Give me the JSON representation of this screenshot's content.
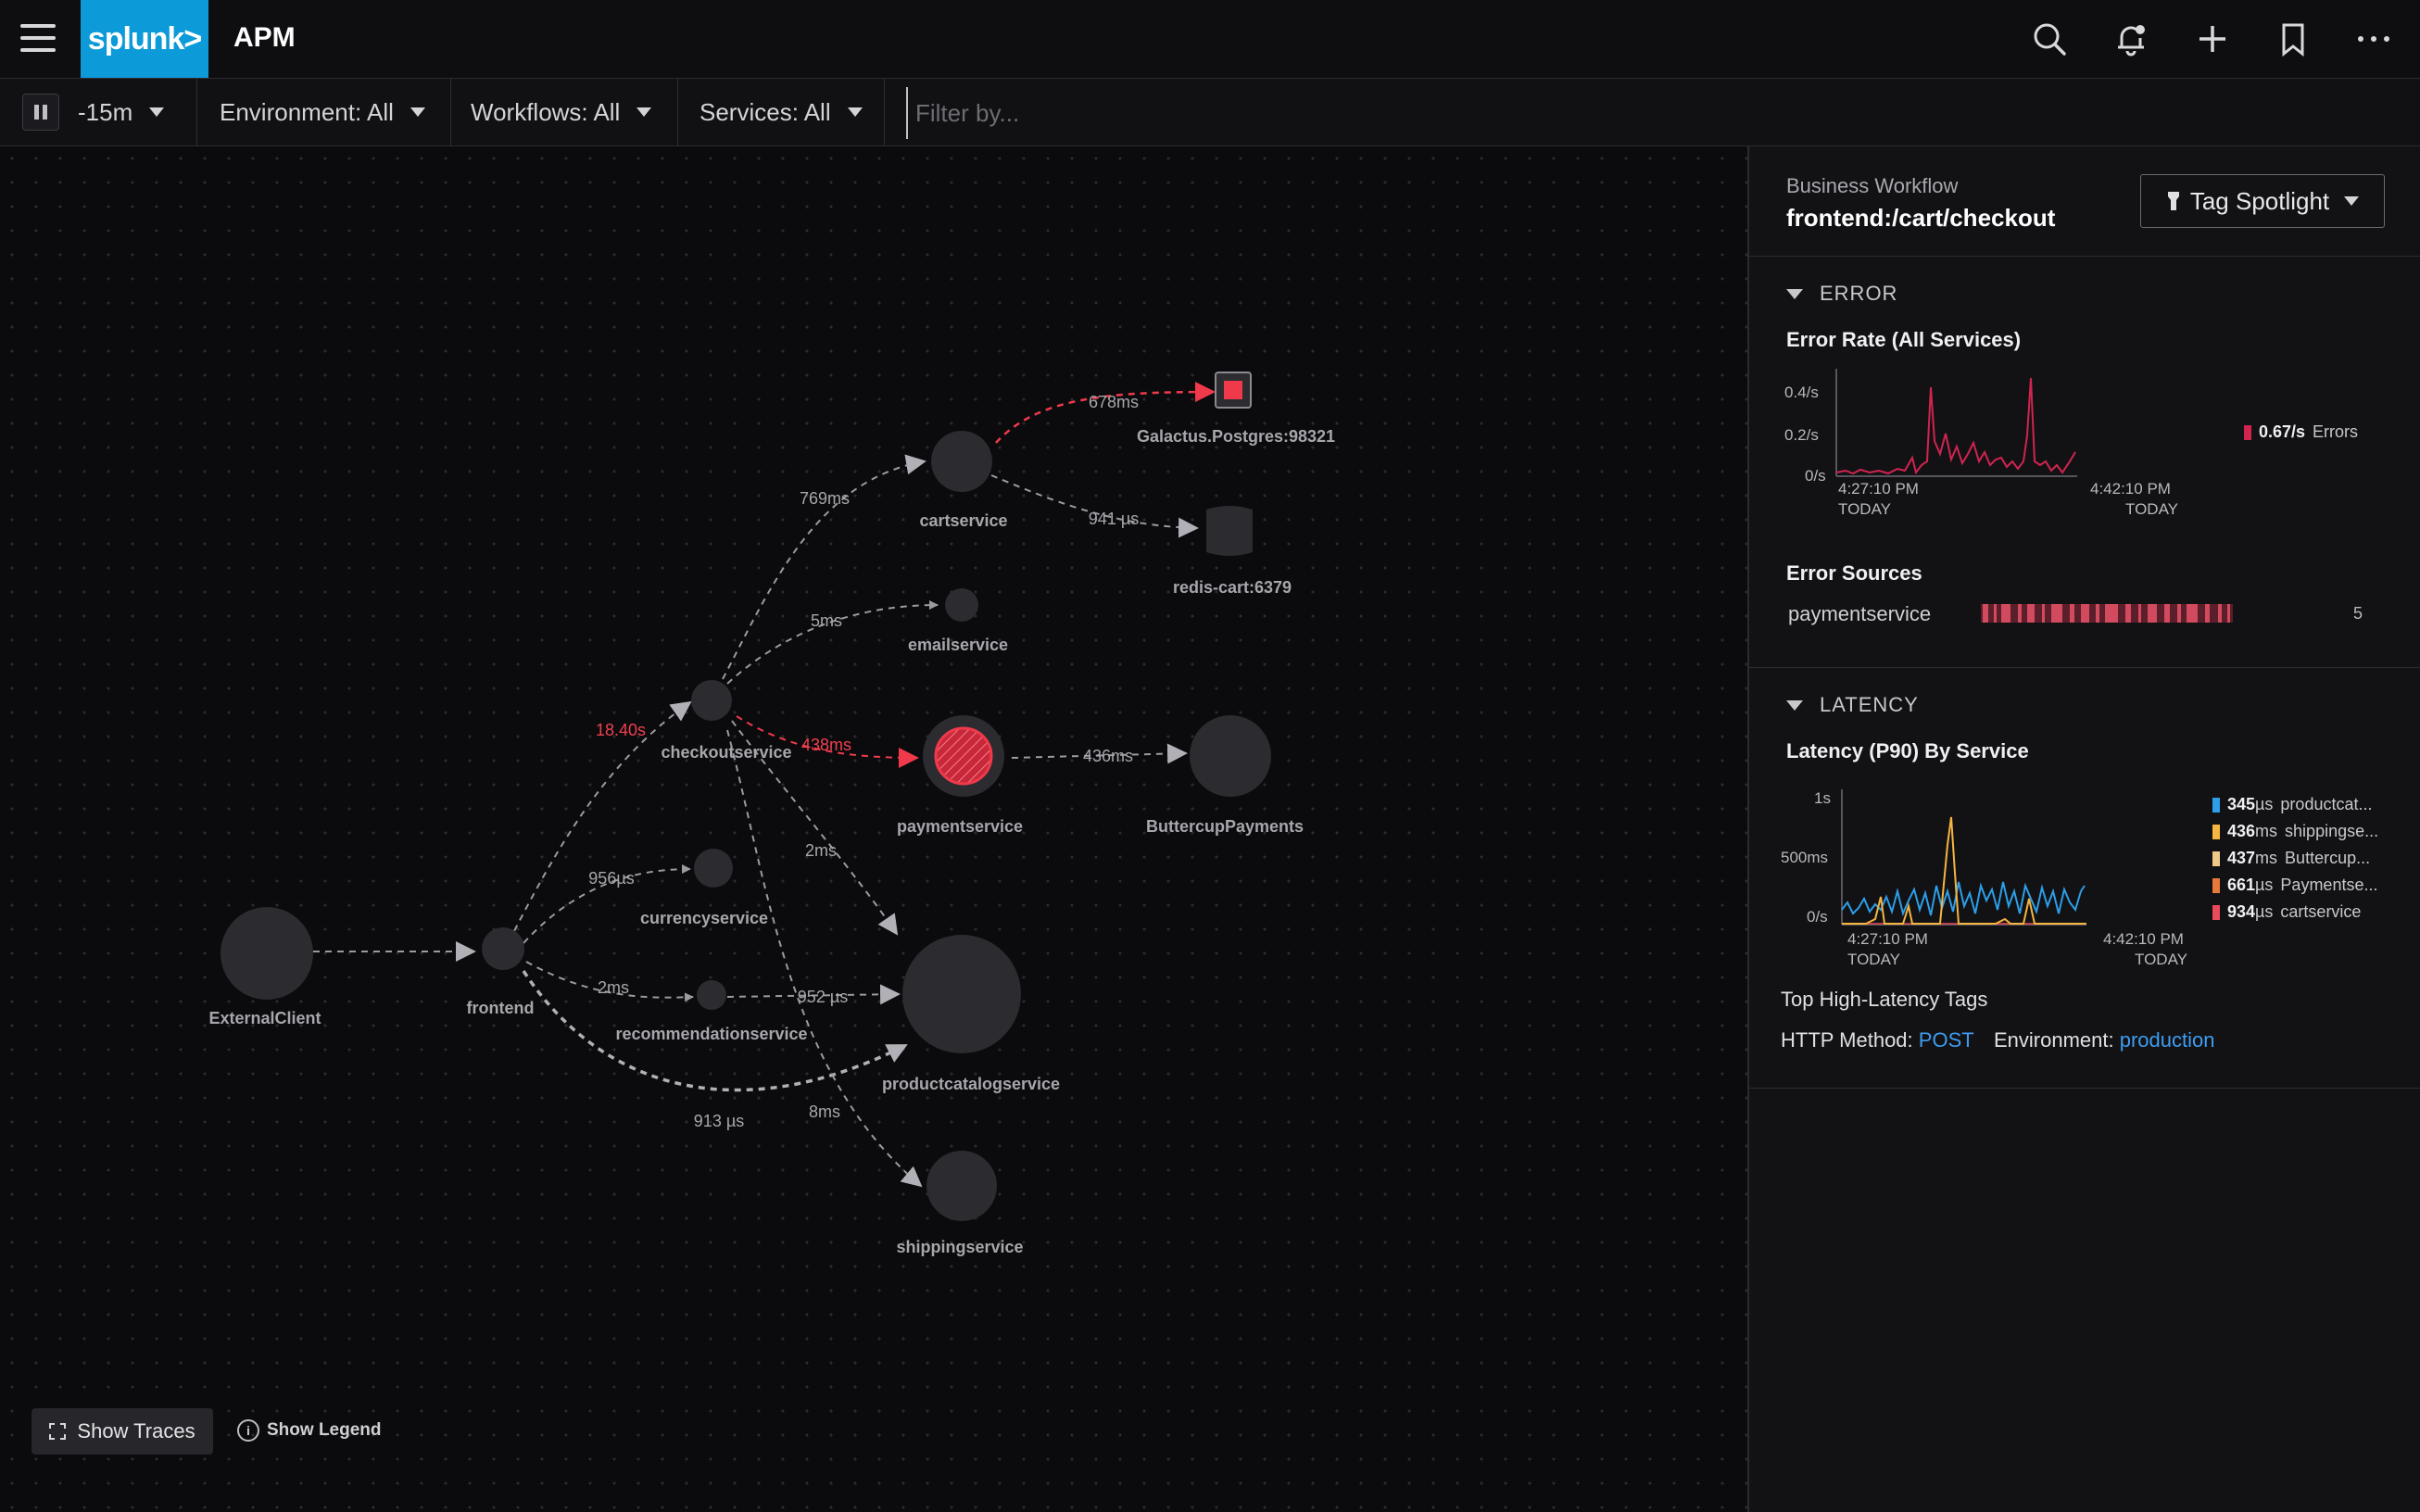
{
  "app": {
    "logo": "splunk>",
    "title": "APM"
  },
  "filters": {
    "time": "-15m",
    "environment": "Environment: All",
    "workflows": "Workflows: All",
    "services": "Services: All",
    "filter_placeholder": "Filter by..."
  },
  "map": {
    "nodes": {
      "galactus": "Galactus.Postgres:98321",
      "cartservice": "cartservice",
      "redis": "redis-cart:6379",
      "emailservice": "emailservice",
      "checkoutservice": "checkoutservice",
      "paymentservice": "paymentservice",
      "buttercup": "ButtercupPayments",
      "currencyservice": "currencyservice",
      "externalclient": "ExternalClient",
      "frontend": "frontend",
      "recommendationservice": "recommendationservice",
      "productcatalogservice": "productcatalogservice",
      "shippingservice": "shippingservice"
    },
    "edges": {
      "cart_galactus": "678ms",
      "cart_redis": "941 µs",
      "checkout_cart": "769ms",
      "checkout_email": "5ms",
      "frontend_checkout": "18.40s",
      "checkout_payment": "438ms",
      "payment_buttercup": "436ms",
      "checkout_catalog": "2ms",
      "frontend_currency": "956µs",
      "frontend_recommendation": "2ms",
      "recommendation_catalog": "952 µs",
      "frontend_catalog": "913 µs",
      "checkout_shipping": "8ms"
    },
    "show_traces": "Show Traces",
    "show_legend": "Show Legend"
  },
  "panel": {
    "workflow_label": "Business Workflow",
    "workflow_value": "frontend:/cart/checkout",
    "tag_spotlight": "Tag Spotlight",
    "error": {
      "heading": "ERROR",
      "rate_title": "Error Rate (All Services)",
      "y_ticks": [
        "0.4/s",
        "0.2/s",
        "0/s"
      ],
      "x_start": "4:27:10 PM",
      "x_end": "4:42:10 PM",
      "x_sub": "TODAY",
      "legend_value": "0.67/s",
      "legend_name": "Errors",
      "sources_title": "Error Sources",
      "source_name": "paymentservice",
      "source_count": "5"
    },
    "latency": {
      "heading": "LATENCY",
      "title": "Latency (P90) By Service",
      "y_ticks": [
        "1s",
        "500ms",
        "0/s"
      ],
      "x_start": "4:27:10 PM",
      "x_end": "4:42:10 PM",
      "x_sub": "TODAY",
      "legend": [
        {
          "value": "345",
          "unit": "µs",
          "name": "productcat...",
          "color": "#2d9ee8"
        },
        {
          "value": "436",
          "unit": "ms",
          "name": "shippingse...",
          "color": "#f5b53f"
        },
        {
          "value": "437",
          "unit": "ms",
          "name": "Buttercup...",
          "color": "#f0c98a"
        },
        {
          "value": "661",
          "unit": "µs",
          "name": "Paymentse...",
          "color": "#e8793a"
        },
        {
          "value": "934",
          "unit": "µs",
          "name": "cartservice",
          "color": "#e94b5b"
        }
      ],
      "tags_title": "Top High-Latency Tags",
      "tag1_label": "HTTP Method:",
      "tag1_value": "POST",
      "tag2_label": "Environment:",
      "tag2_value": "production"
    }
  },
  "colors": {
    "accent": "#0c9ad8",
    "error": "#e8364a",
    "link": "#3e9cf0"
  }
}
